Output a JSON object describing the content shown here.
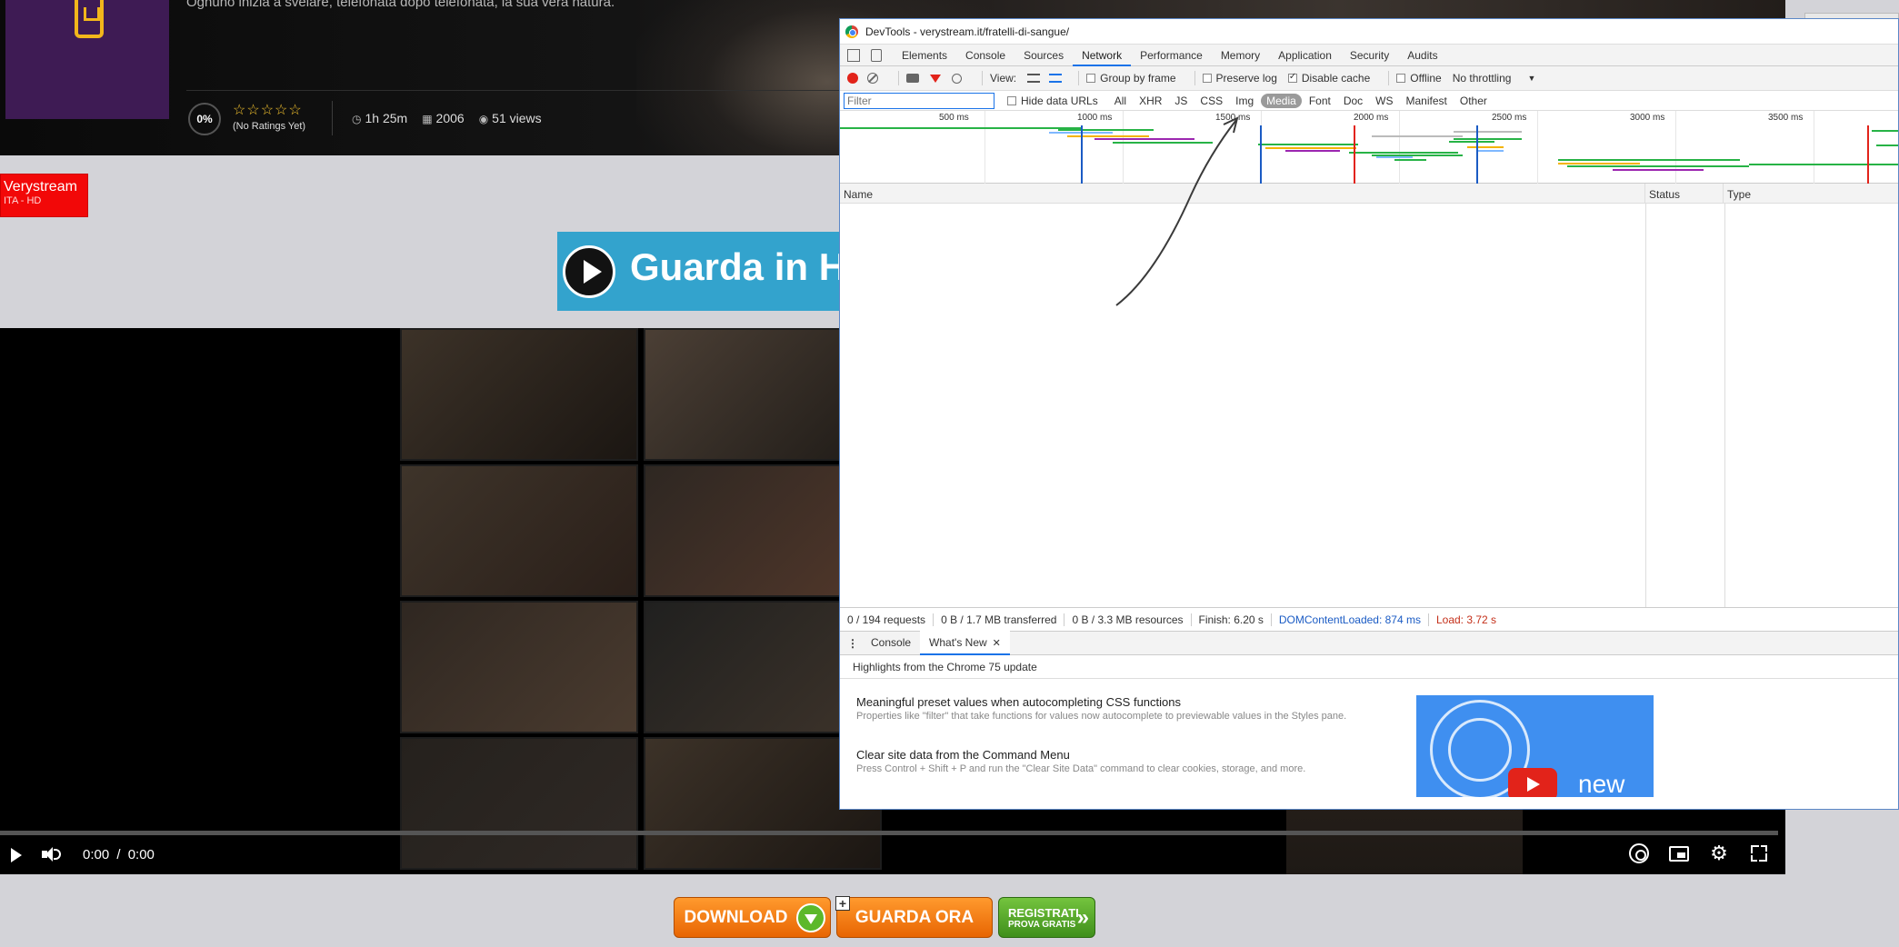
{
  "hero": {
    "synopsis": "Ognuno inizia a svelare, telefonata dopo telefonata, la sua vera natura.",
    "rating_percent": "0%",
    "stars": "☆☆☆☆☆",
    "rating_note": "(No Ratings Yet)",
    "duration": "1h 25m",
    "year": "2006",
    "views": "51 views"
  },
  "host": {
    "name": "Verystream",
    "sub": "ITA - HD"
  },
  "watch_banner": {
    "text": "Guarda in H"
  },
  "player": {
    "time": "0:00  /  0:00",
    "progress": 0
  },
  "cta": {
    "download": "DOWNLOAD",
    "guarda": "GUARDA ORA",
    "guarda_plus": "+",
    "register_line1": "REGISTRATI",
    "register_line2": "PROVA GRATIS",
    "register_chevron": "»"
  },
  "devtools": {
    "title": "DevTools - verystream.it/fratelli-di-sangue/",
    "tabs": [
      "Elements",
      "Console",
      "Sources",
      "Network",
      "Performance",
      "Memory",
      "Application",
      "Security",
      "Audits"
    ],
    "active_tab": "Network",
    "toolbar": {
      "view_label": "View:",
      "group_by_frame": "Group by frame",
      "preserve_log": "Preserve log",
      "disable_cache": "Disable cache",
      "offline": "Offline",
      "throttling": "No throttling",
      "throttling_arrow": "▼"
    },
    "filter": {
      "placeholder": "Filter",
      "hide_data_urls": "Hide data URLs",
      "types": [
        "All",
        "XHR",
        "JS",
        "CSS",
        "Img",
        "Media",
        "Font",
        "Doc",
        "WS",
        "Manifest",
        "Other"
      ],
      "selected_type": "Media"
    },
    "overview_ticks": [
      "500 ms",
      "1000 ms",
      "1500 ms",
      "2000 ms",
      "2500 ms",
      "3000 ms",
      "3500 ms"
    ],
    "columns": {
      "name": "Name",
      "status": "Status",
      "type": "Type"
    },
    "summary": {
      "requests": "0 / 194 requests",
      "transferred": "0 B / 1.7 MB transferred",
      "resources": "0 B / 3.3 MB resources",
      "finish": "Finish: 6.20 s",
      "dom_content_loaded": "DOMContentLoaded: 874 ms",
      "load": "Load: 3.72 s"
    },
    "drawer": {
      "kebab": "⋮",
      "tabs": [
        "Console",
        "What's New"
      ],
      "active": "What's New",
      "close": "✕",
      "highlights": "Highlights from the Chrome 75 update",
      "items": [
        {
          "title": "Meaningful preset values when autocompleting CSS functions",
          "desc": "Properties like \"filter\" that take functions for values now autocomplete to previewable values in the Styles pane."
        },
        {
          "title": "Clear site data from the Command Menu",
          "desc": "Press Control + Shift + P and run the \"Clear Site Data\" command to clear cookies, storage, and more."
        }
      ],
      "image_word": "new"
    }
  },
  "colors": {
    "host_badge": "#f20808",
    "banner": "#33a3cd",
    "download": "#e86503",
    "register": "#5aae2c",
    "devtools_accent": "#1a73e8",
    "dcl": "#1a5bc4",
    "load": "#c4301a"
  },
  "icons": [
    "clock-icon",
    "calendar-icon",
    "eye-icon",
    "play-icon",
    "volume-icon",
    "chromecast-icon",
    "pip-icon",
    "gear-icon",
    "fullscreen-icon",
    "chrome-icon",
    "record-icon",
    "clear-icon",
    "camera-icon",
    "filter-icon",
    "search-icon",
    "close-icon"
  ]
}
